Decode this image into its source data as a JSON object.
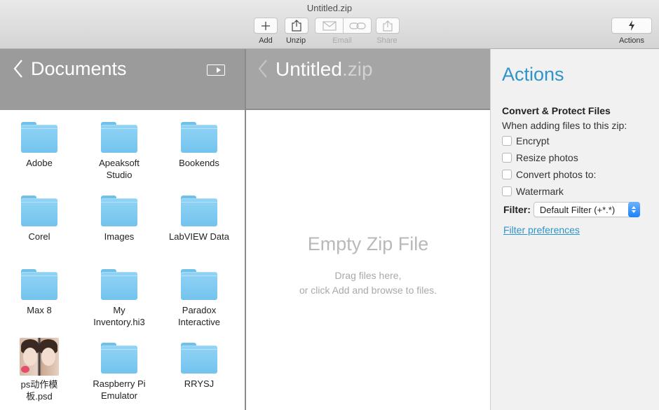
{
  "window": {
    "title": "Untitled.zip"
  },
  "toolbar": {
    "add_label": "Add",
    "unzip_label": "Unzip",
    "email_label": "Email",
    "share_label": "Share",
    "actions_label": "Actions"
  },
  "left": {
    "title": "Documents",
    "items": [
      {
        "label": "Adobe",
        "type": "folder"
      },
      {
        "label": "Apeaksoft Studio",
        "type": "folder"
      },
      {
        "label": "Bookends",
        "type": "folder"
      },
      {
        "label": "Corel",
        "type": "folder"
      },
      {
        "label": "Images",
        "type": "folder"
      },
      {
        "label": "LabVIEW Data",
        "type": "folder"
      },
      {
        "label": "Max 8",
        "type": "folder"
      },
      {
        "label": "My Inventory.hi3",
        "type": "folder"
      },
      {
        "label": "Paradox Interactive",
        "type": "folder"
      },
      {
        "label": "ps动作模板.psd",
        "type": "image"
      },
      {
        "label": "Raspberry Pi Emulator",
        "type": "folder"
      },
      {
        "label": "RRYSJ",
        "type": "folder"
      }
    ]
  },
  "middle": {
    "title_name": "Untitled",
    "title_ext": ".zip",
    "empty_title": "Empty Zip File",
    "empty_line1": "Drag files here,",
    "empty_line2": "or click Add and browse to files."
  },
  "actions": {
    "title": "Actions",
    "section_title": "Convert & Protect Files",
    "section_sub": "When adding files to this zip:",
    "options": [
      "Encrypt",
      "Resize photos",
      "Convert photos to:",
      "Watermark"
    ],
    "filter_label": "Filter:",
    "filter_value": "Default Filter (+*.*)",
    "filter_link": "Filter preferences"
  },
  "colors": {
    "accent": "#2e94c9",
    "folder": "#7fc9f0",
    "header_gray": "#9b9b9b"
  }
}
